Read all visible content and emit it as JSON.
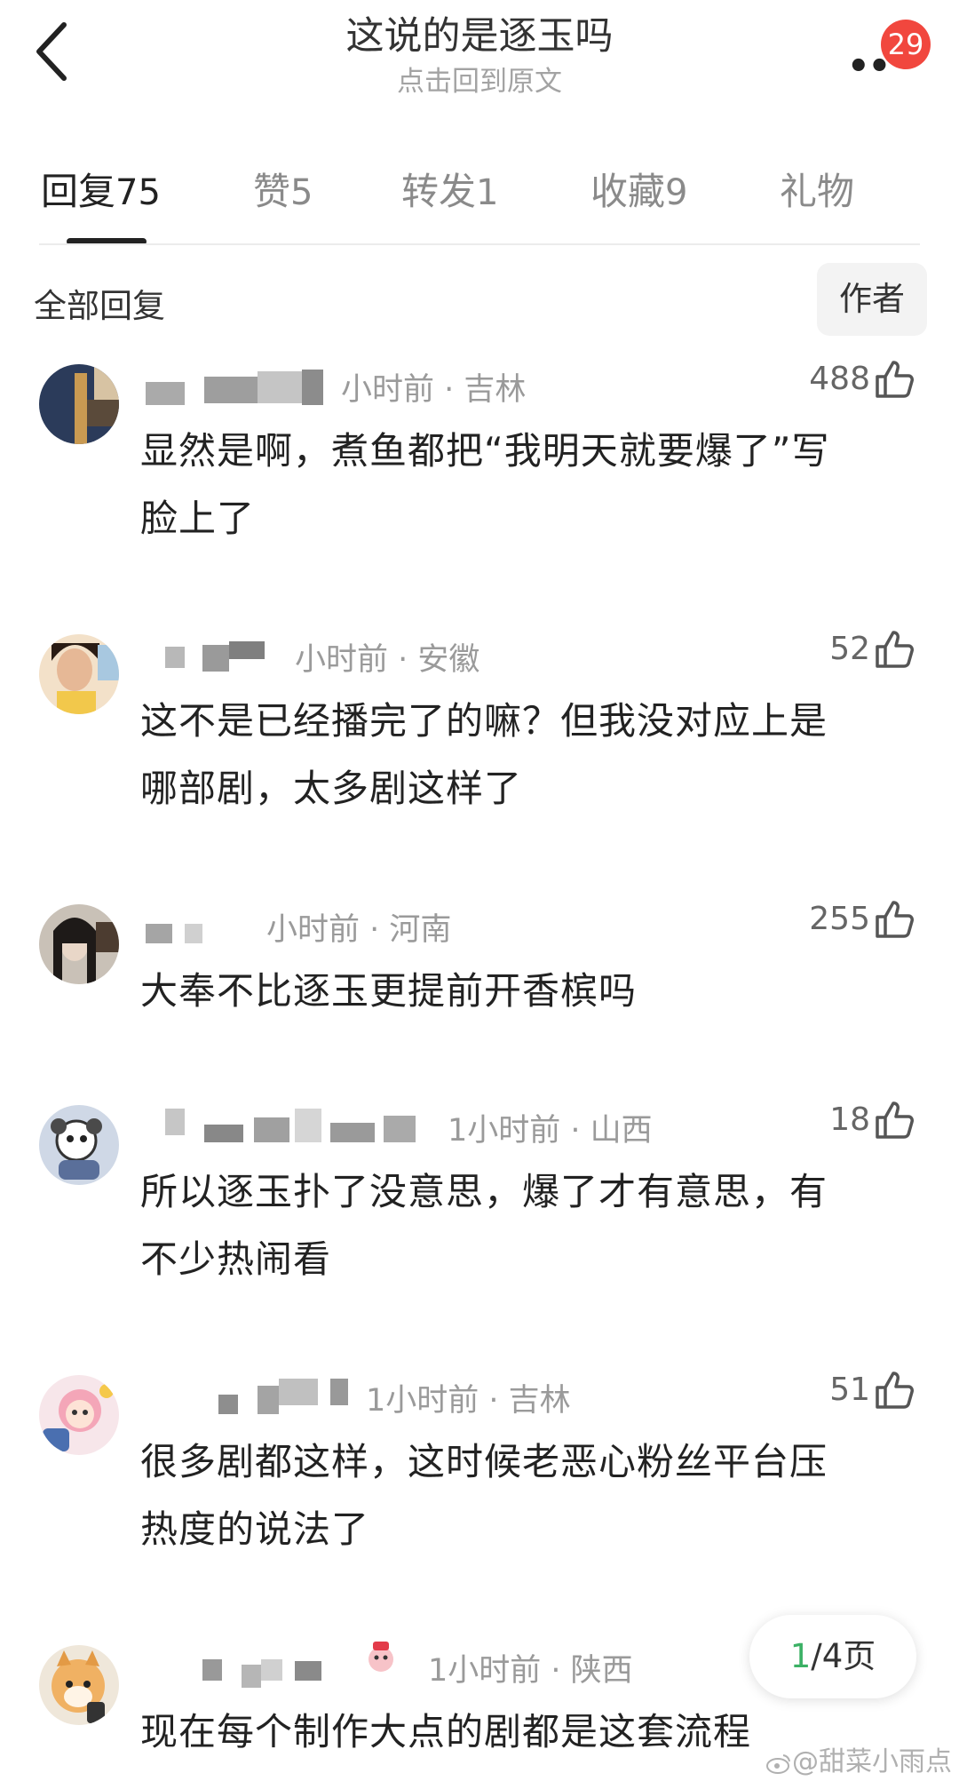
{
  "header": {
    "title": "这说的是逐玉吗",
    "subtitle": "点击回到原文",
    "badge_count": "29",
    "icons": {
      "back": "chevron-left-icon",
      "more": "more-dots-icon"
    }
  },
  "tabs": [
    {
      "label": "回复",
      "count": "75",
      "active": true
    },
    {
      "label": "赞",
      "count": "5",
      "active": false
    },
    {
      "label": "转发",
      "count": "1",
      "active": false
    },
    {
      "label": "收藏",
      "count": "9",
      "active": false
    },
    {
      "label": "礼物",
      "count": "",
      "active": false
    }
  ],
  "filter": {
    "label": "全部回复",
    "author_button": "作者"
  },
  "comments": [
    {
      "meta": "小时前 · 吉林",
      "likes": "488",
      "lines": [
        "显然是啊，煮鱼都把“我明天就要爆了”写",
        "脸上了"
      ]
    },
    {
      "meta": "小时前 · 安徽",
      "likes": "52",
      "lines": [
        "这不是已经播完了的嘛？但我没对应上是",
        "哪部剧，太多剧这样了"
      ]
    },
    {
      "meta": "小时前 · 河南",
      "likes": "255",
      "lines": [
        "大奉不比逐玉更提前开香槟吗"
      ]
    },
    {
      "meta": "1小时前 · 山西",
      "likes": "18",
      "lines": [
        "所以逐玉扑了没意思，爆了才有意思，有",
        "不少热闹看"
      ]
    },
    {
      "meta": "1小时前 · 吉林",
      "likes": "51",
      "lines": [
        "很多剧都这样，这时候老恶心粉丝平台压",
        "热度的说法了"
      ]
    },
    {
      "meta": "1小时前 · 陕西",
      "likes": "",
      "lines": [
        "现在每个制作大点的剧都是这套流程"
      ]
    }
  ],
  "pager": {
    "current": "1",
    "total": "/4页"
  },
  "watermark": "@甜菜小雨点",
  "colors": {
    "badge": "#f1473e",
    "pager_current": "#3bb165",
    "meta": "#9a9a9a"
  }
}
